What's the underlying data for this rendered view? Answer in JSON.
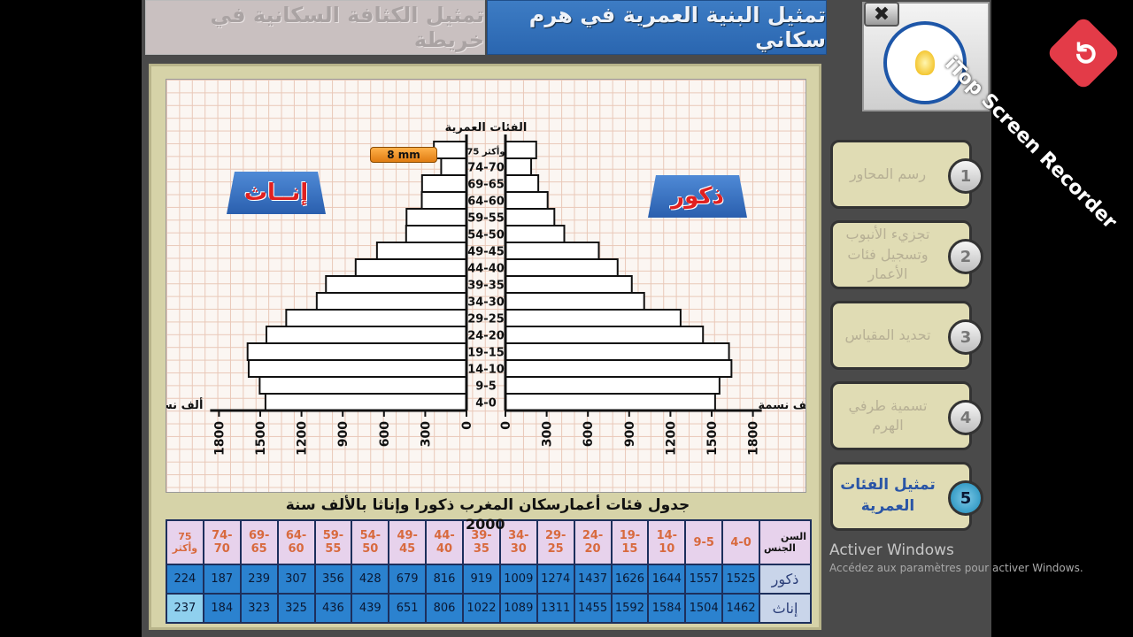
{
  "tabs": {
    "density": "تمثيل الكثافة السكانية في خريطة",
    "pyramid": "تمثيل البنية العمرية في هرم سكاني"
  },
  "close_icon": "✖",
  "chart": {
    "axis_title": "الفئات العمرية",
    "scale_badge": "8 mm",
    "males_tag": "ذكور",
    "females_tag": "إنــاث",
    "unit_left": "ألف نسمة",
    "unit_right": "ألف نسمة",
    "ticks": [
      "0",
      "300",
      "600",
      "900",
      "1200",
      "1500",
      "1800"
    ]
  },
  "chart_data": {
    "type": "bar",
    "categories": [
      "4-0",
      "9-5",
      "14-10",
      "19-15",
      "24-20",
      "29-25",
      "34-30",
      "39-35",
      "44-40",
      "49-45",
      "54-50",
      "59-55",
      "64-60",
      "69-65",
      "74-70",
      "75 وأكثر"
    ],
    "series": [
      {
        "name": "ذكور",
        "values": [
          1525,
          1557,
          1644,
          1626,
          1437,
          1274,
          1009,
          919,
          816,
          679,
          428,
          356,
          307,
          239,
          187,
          224
        ]
      },
      {
        "name": "إناث",
        "values": [
          1462,
          1504,
          1584,
          1592,
          1455,
          1311,
          1089,
          1022,
          806,
          651,
          439,
          436,
          325,
          323,
          184,
          237
        ]
      }
    ],
    "xlabel": "ألف نسمة",
    "ylabel": "الفئات العمرية",
    "xlim": [
      0,
      1800
    ]
  },
  "table": {
    "title": "جدول فئات أعمارسكان المغرب ذكورا وإناثا بالألف سنة",
    "year": "2000",
    "corner_top": "السن",
    "corner_bottom": "الجنس",
    "headers": [
      "4-0",
      "9-5",
      "14-10",
      "19-15",
      "24-20",
      "29-25",
      "34-30",
      "39-35",
      "44-40",
      "49-45",
      "54-50",
      "59-55",
      "64-60",
      "69-65",
      "74-70",
      "75 وأكثر"
    ],
    "males_label": "ذكور",
    "females_label": "إناث",
    "males": [
      "1525",
      "1557",
      "1644",
      "1626",
      "1437",
      "1274",
      "1009",
      "919",
      "816",
      "679",
      "428",
      "356",
      "307",
      "239",
      "187",
      "224"
    ],
    "females": [
      "1462",
      "1504",
      "1584",
      "1592",
      "1455",
      "1311",
      "1089",
      "1022",
      "806",
      "651",
      "439",
      "436",
      "325",
      "323",
      "184",
      "237"
    ]
  },
  "steps": [
    {
      "num": "1",
      "label": "رسم المحاور"
    },
    {
      "num": "2",
      "label": "تجزيء الأنبوب وتسجيل فئات الأعمار"
    },
    {
      "num": "3",
      "label": "تحديد المقياس"
    },
    {
      "num": "4",
      "label": "تسمية طرفي الهرم"
    },
    {
      "num": "5",
      "label": "تمثيل الفئات العمرية"
    }
  ],
  "windows": {
    "activate": "Activer Windows",
    "activate_sub": "Accédez aux paramètres pour activer Windows."
  },
  "watermark": "iTop Screen Recorder"
}
